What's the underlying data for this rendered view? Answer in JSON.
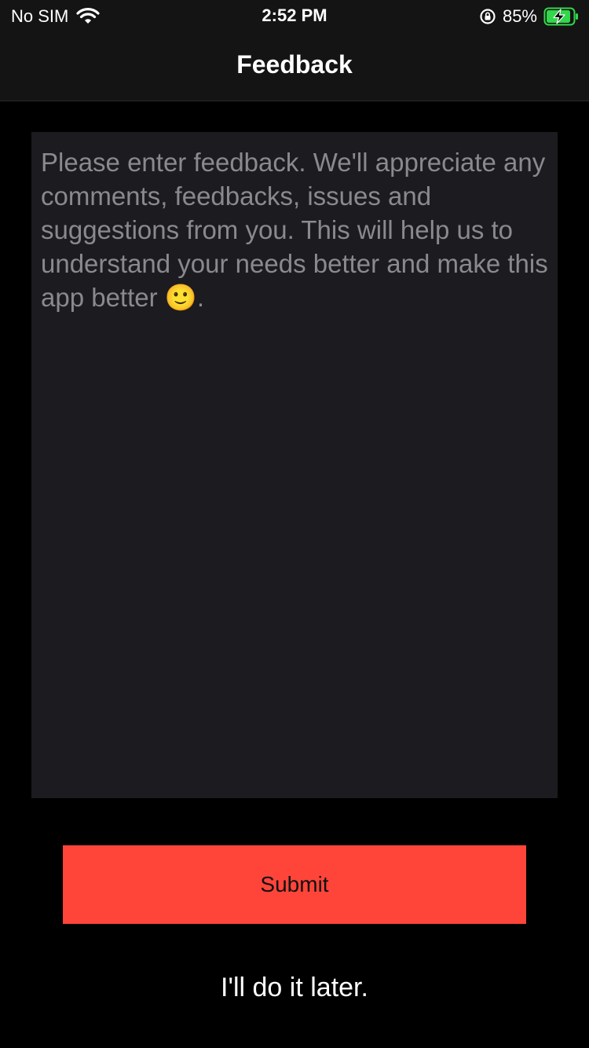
{
  "status_bar": {
    "carrier": "No SIM",
    "time": "2:52 PM",
    "battery_percent": "85%",
    "icons": [
      "wifi-icon",
      "lock-rotation-icon",
      "battery-charging-icon"
    ],
    "battery_color": "#32d74b"
  },
  "nav": {
    "title": "Feedback"
  },
  "feedback": {
    "value": "",
    "placeholder": "Please enter feedback. We'll appreciate any comments, feedbacks, issues and suggestions from you. This will help us to understand your needs better and make this app better 🙂."
  },
  "actions": {
    "submit_label": "Submit",
    "submit_color": "#ff453a",
    "later_label": "I'll do it later."
  }
}
